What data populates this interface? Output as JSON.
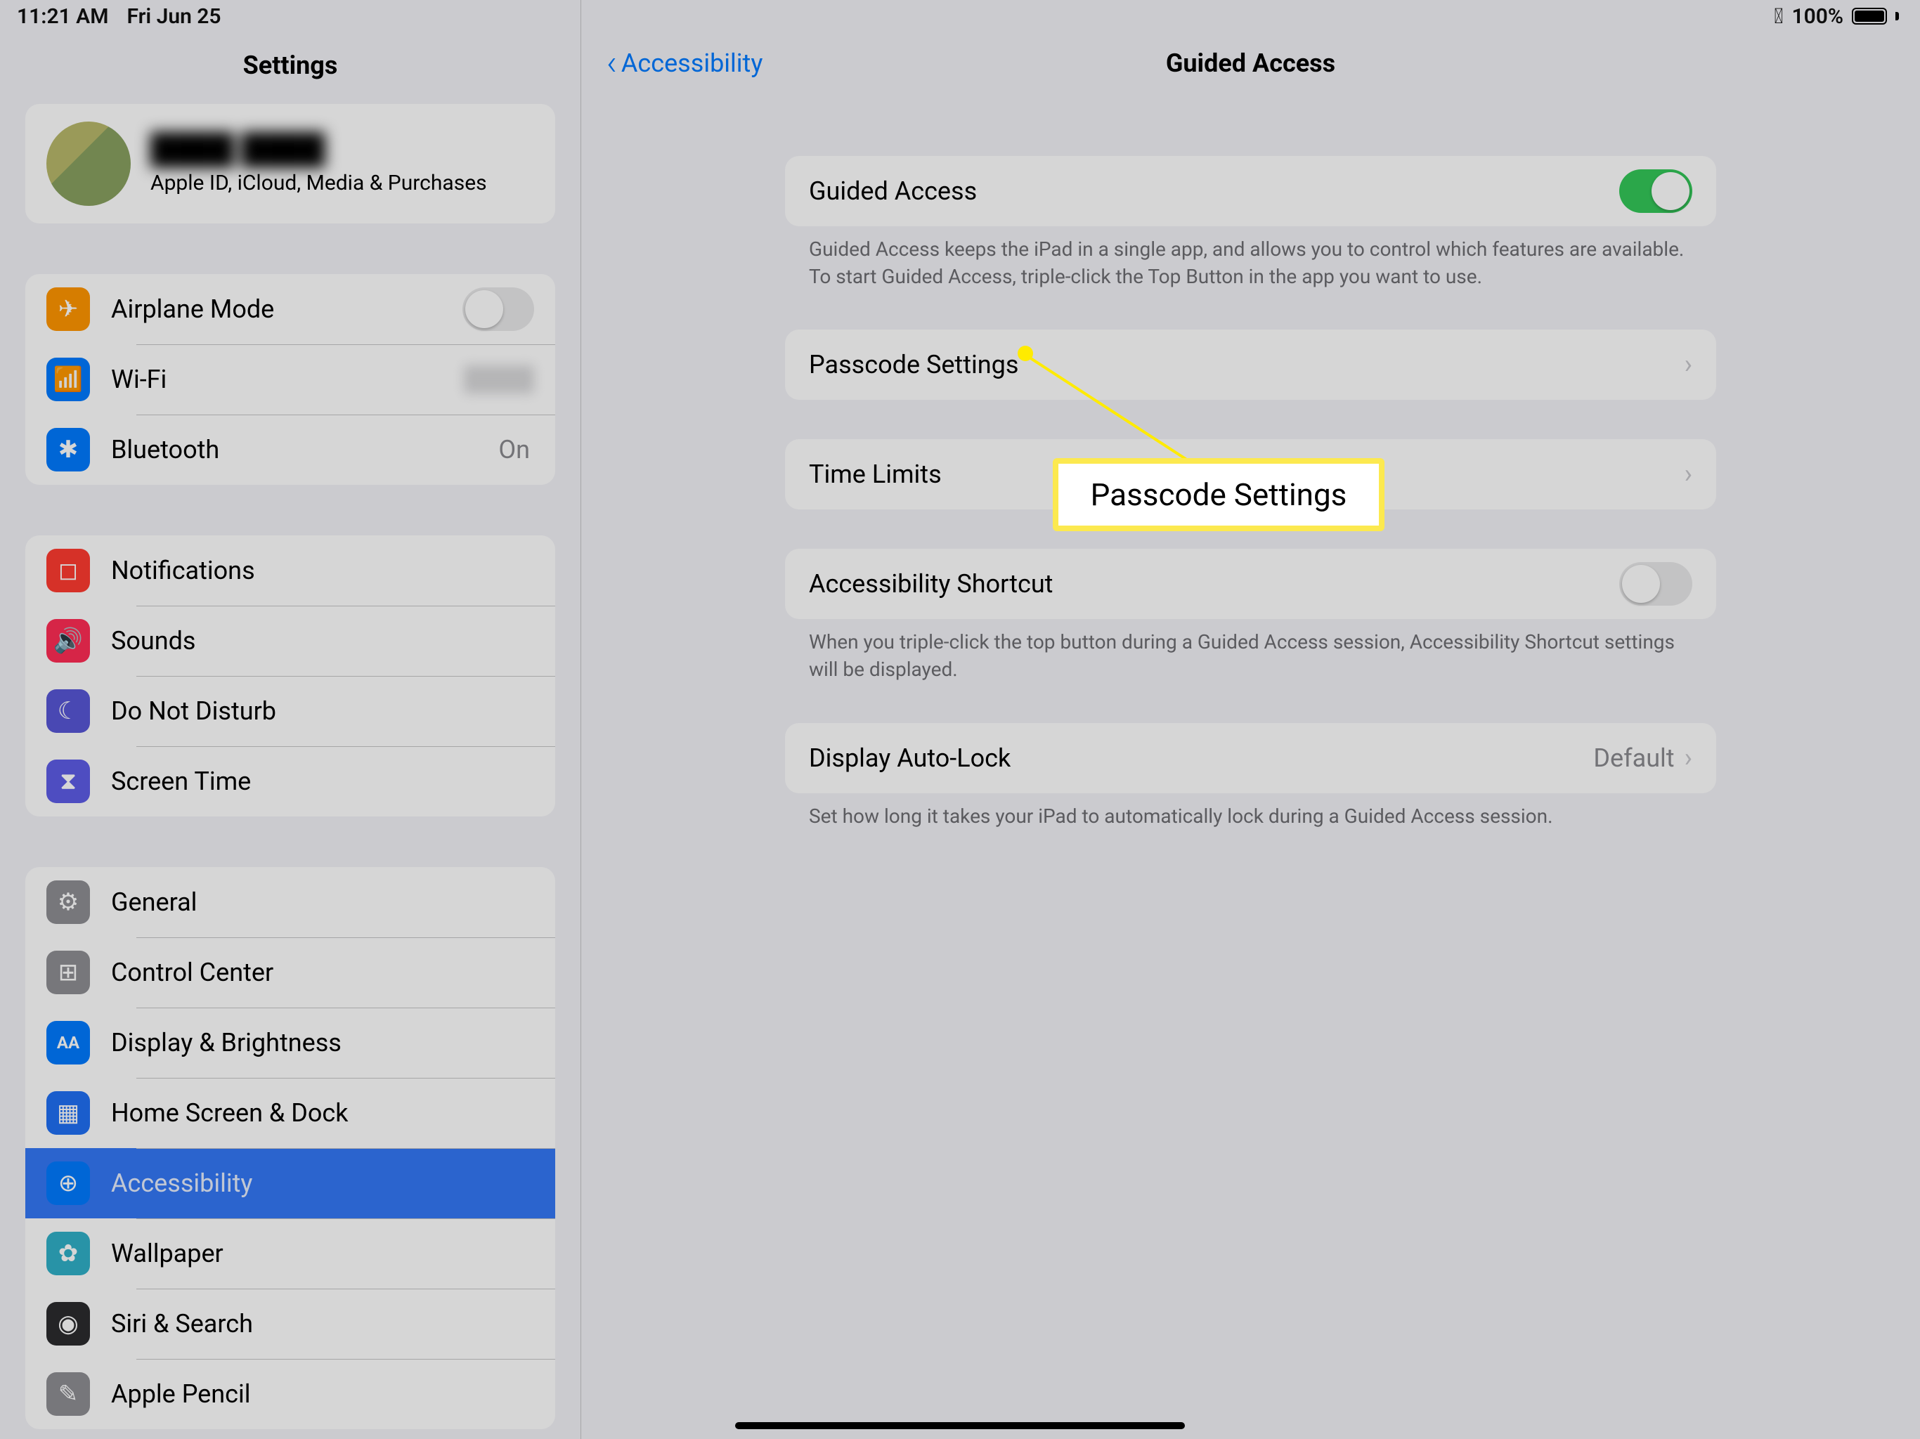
{
  "status": {
    "time": "11:21 AM",
    "date": "Fri Jun 25",
    "battery_pct": "100%"
  },
  "sidebar": {
    "title": "Settings",
    "user_subtitle": "Apple ID, iCloud, Media & Purchases",
    "groups": [
      [
        {
          "label": "Airplane Mode",
          "icon": "✈",
          "color": "c-orange",
          "switch": false
        },
        {
          "label": "Wi-Fi",
          "icon": "📶",
          "color": "c-blue",
          "value_blur": true
        },
        {
          "label": "Bluetooth",
          "icon": "✱",
          "color": "c-blue",
          "value": "On"
        }
      ],
      [
        {
          "label": "Notifications",
          "icon": "◻",
          "color": "c-red"
        },
        {
          "label": "Sounds",
          "icon": "🔊",
          "color": "c-red2"
        },
        {
          "label": "Do Not Disturb",
          "icon": "☾",
          "color": "c-purple"
        },
        {
          "label": "Screen Time",
          "icon": "⧗",
          "color": "c-indigo"
        }
      ],
      [
        {
          "label": "General",
          "icon": "⚙",
          "color": "c-gray"
        },
        {
          "label": "Control Center",
          "icon": "⊞",
          "color": "c-gray"
        },
        {
          "label": "Display & Brightness",
          "icon": "AA",
          "color": "c-blue",
          "small_text": true
        },
        {
          "label": "Home Screen & Dock",
          "icon": "▦",
          "color": "c-blue2"
        },
        {
          "label": "Accessibility",
          "icon": "⊕",
          "color": "c-blue",
          "selected": true
        },
        {
          "label": "Wallpaper",
          "icon": "✿",
          "color": "c-teal"
        },
        {
          "label": "Siri & Search",
          "icon": "◉",
          "color": "c-dark"
        },
        {
          "label": "Apple Pencil",
          "icon": "✎",
          "color": "c-gray"
        }
      ]
    ]
  },
  "detail": {
    "back_label": "Accessibility",
    "title": "Guided Access",
    "sections": [
      {
        "rows": [
          {
            "label": "Guided Access",
            "switch_on": true
          }
        ],
        "note": "Guided Access keeps the iPad in a single app, and allows you to control which features are available. To start Guided Access, triple-click the Top Button in the app you want to use."
      },
      {
        "rows": [
          {
            "label": "Passcode Settings",
            "chevron": true
          }
        ],
        "spaced": true
      },
      {
        "rows": [
          {
            "label": "Time Limits",
            "chevron": true
          }
        ],
        "spaced": true
      },
      {
        "rows": [
          {
            "label": "Accessibility Shortcut",
            "switch_on": false
          }
        ],
        "note": "When you triple-click the top button during a Guided Access session, Accessibility Shortcut settings will be displayed."
      },
      {
        "rows": [
          {
            "label": "Display Auto-Lock",
            "value": "Default",
            "chevron": true
          }
        ],
        "note": "Set how long it takes your iPad to automatically lock during a Guided Access session."
      }
    ]
  },
  "callout": {
    "text": "Passcode Settings"
  }
}
